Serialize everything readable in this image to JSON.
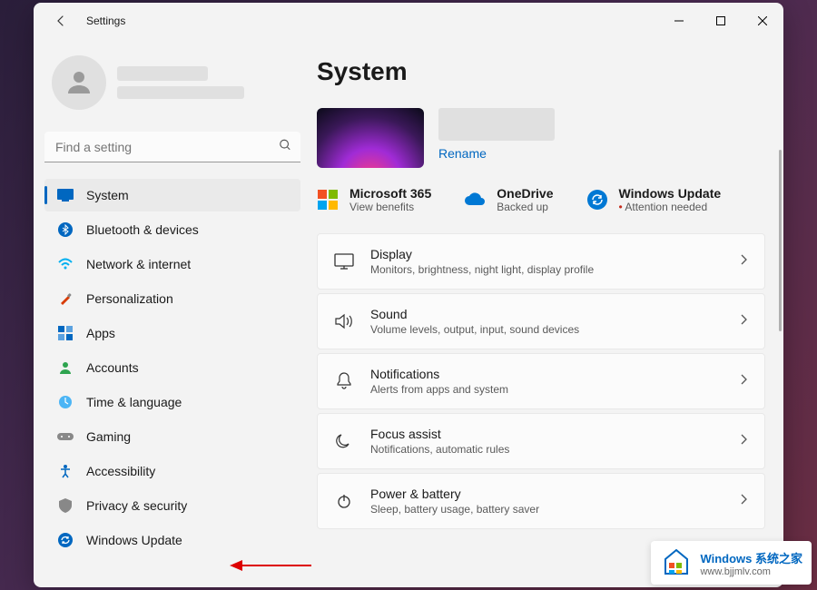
{
  "window": {
    "title": "Settings"
  },
  "search": {
    "placeholder": "Find a setting"
  },
  "sidebar": {
    "items": [
      {
        "label": "System"
      },
      {
        "label": "Bluetooth & devices"
      },
      {
        "label": "Network & internet"
      },
      {
        "label": "Personalization"
      },
      {
        "label": "Apps"
      },
      {
        "label": "Accounts"
      },
      {
        "label": "Time & language"
      },
      {
        "label": "Gaming"
      },
      {
        "label": "Accessibility"
      },
      {
        "label": "Privacy & security"
      },
      {
        "label": "Windows Update"
      }
    ]
  },
  "page": {
    "title": "System",
    "rename": "Rename"
  },
  "status": {
    "m365": {
      "title": "Microsoft 365",
      "sub": "View benefits"
    },
    "onedrive": {
      "title": "OneDrive",
      "sub": "Backed up"
    },
    "update": {
      "title": "Windows Update",
      "sub": "Attention needed"
    }
  },
  "cards": [
    {
      "title": "Display",
      "sub": "Monitors, brightness, night light, display profile"
    },
    {
      "title": "Sound",
      "sub": "Volume levels, output, input, sound devices"
    },
    {
      "title": "Notifications",
      "sub": "Alerts from apps and system"
    },
    {
      "title": "Focus assist",
      "sub": "Notifications, automatic rules"
    },
    {
      "title": "Power & battery",
      "sub": "Sleep, battery usage, battery saver"
    }
  ],
  "watermark": {
    "line1": "Windows 系统之家",
    "line2": "www.bjjmlv.com"
  }
}
